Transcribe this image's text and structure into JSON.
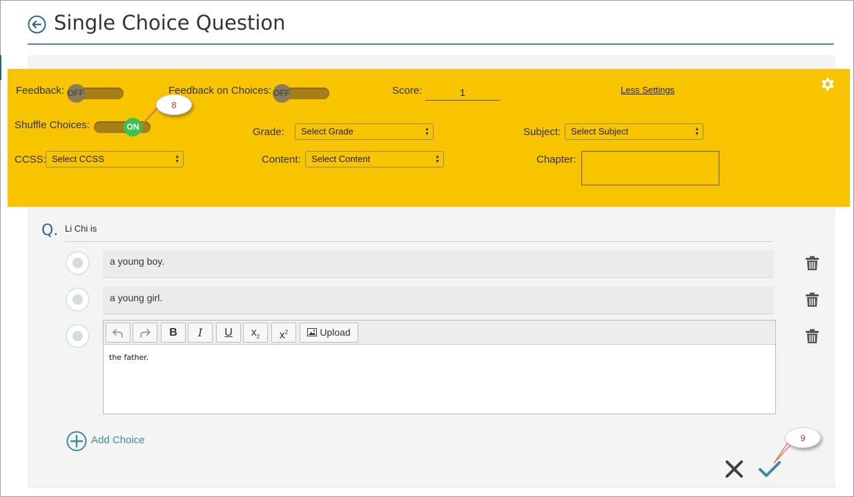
{
  "header": {
    "title": "Single Choice Question"
  },
  "settings": {
    "feedback_label": "Feedback:",
    "feedback_state": "OFF",
    "feedback_choices_label": "Feedback on Choices:",
    "feedback_choices_state": "OFF",
    "score_label": "Score:",
    "score_value": "1",
    "less_settings_label": "Less Settings",
    "shuffle_label": "Shuffle Choices:",
    "shuffle_state": "ON",
    "grade_label": "Grade:",
    "grade_value": "Select Grade",
    "subject_label": "Subject:",
    "subject_value": "Select Subject",
    "ccss_label": "CCSS:",
    "ccss_value": "Select CCSS",
    "content_label": "Content:",
    "content_value": "Select Content",
    "chapter_label": "Chapter:",
    "chapter_value": ""
  },
  "callouts": {
    "first": "8",
    "second": "9"
  },
  "question": {
    "marker": "Q.",
    "text": "Li Chi is"
  },
  "choices": [
    {
      "text": "a young boy."
    },
    {
      "text": "a young girl."
    }
  ],
  "editor": {
    "upload_label": "Upload",
    "text": "the father."
  },
  "add_choice_label": "Add Choice",
  "colors": {
    "accent": "#3b8aa0",
    "settings_bg": "#f8c400",
    "toggle_on": "#3ec24f",
    "callout_text": "#c0392b"
  }
}
